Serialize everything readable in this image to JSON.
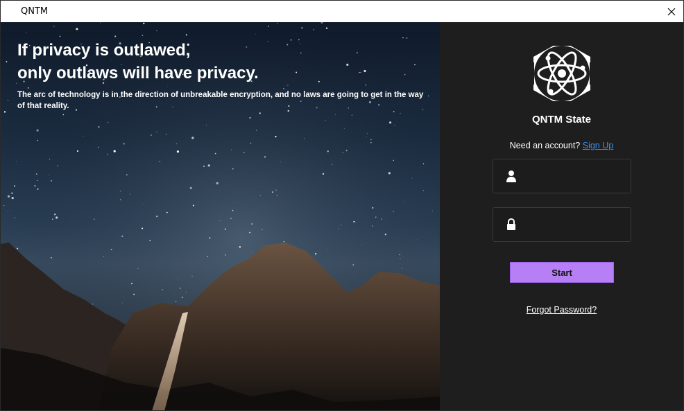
{
  "window": {
    "title": "QNTM"
  },
  "hero": {
    "headline_line1": "If privacy is outlawed,",
    "headline_line2": "only outlaws will have privacy.",
    "subtext": "The arc of technology is in the direction of unbreakable encryption, and no laws are going to get in the way of that reality."
  },
  "panel": {
    "brand_name": "QNTM State",
    "signup_prompt": "Need an account?",
    "signup_link": "Sign Up",
    "username_field": {
      "value": "",
      "placeholder": "",
      "icon": "user-icon"
    },
    "password_field": {
      "value": "",
      "placeholder": "",
      "icon": "lock-icon"
    },
    "start_label": "Start",
    "forgot_label": "Forgot Password?"
  },
  "colors": {
    "panel_bg": "#1e1e1e",
    "accent_button": "#b77ff5",
    "link": "#3b8ee6",
    "field_border": "#3b3b3b"
  }
}
